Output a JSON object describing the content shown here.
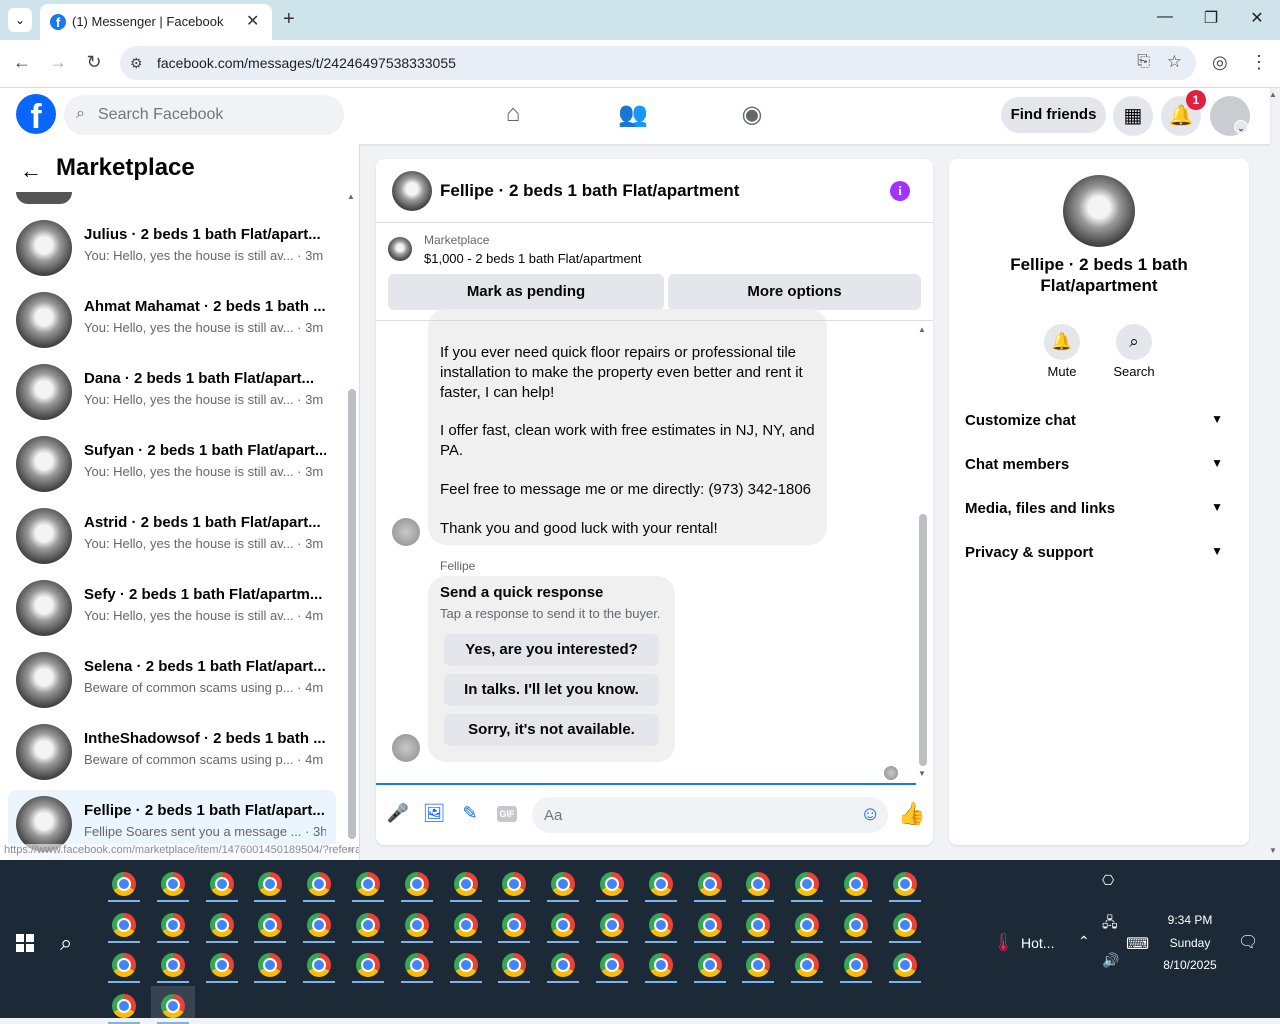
{
  "browser": {
    "tab_title": "(1) Messenger | Facebook",
    "url": "facebook.com/messages/t/24246497538333055",
    "status_url": "https://www.facebook.com/marketplace/item/1476001450189504/?referralS..."
  },
  "fb_header": {
    "search_placeholder": "Search Facebook",
    "find_friends_label": "Find friends",
    "notification_count": "1"
  },
  "left_panel": {
    "title": "Marketplace",
    "conversations": [
      {
        "name": "Julius · 2 beds 1 bath Flat/apart...",
        "preview": "You: Hello, yes the house is still av... · 3m"
      },
      {
        "name": "Ahmat Mahamat · 2 beds 1 bath ...",
        "preview": "You: Hello, yes the house is still av... · 3m"
      },
      {
        "name": "Dana · 2 beds 1 bath Flat/apart...",
        "preview": "You: Hello, yes the house is still av... · 3m"
      },
      {
        "name": "Sufyan · 2 beds 1 bath Flat/apart...",
        "preview": "You: Hello, yes the house is still av... · 3m"
      },
      {
        "name": "Astrid · 2 beds 1 bath Flat/apart...",
        "preview": "You: Hello, yes the house is still av... · 3m"
      },
      {
        "name": "Sefy · 2 beds 1 bath Flat/apartm...",
        "preview": "You: Hello, yes the house is still av... · 4m"
      },
      {
        "name": "Selena · 2 beds 1 bath Flat/apart...",
        "preview": "Beware of common scams using p... · 4m"
      },
      {
        "name": "IntheShadowsof · 2 beds 1 bath ...",
        "preview": "Beware of common scams using p... · 4m"
      },
      {
        "name": "Fellipe · 2 beds 1 bath Flat/apart...",
        "preview": "Fellipe Soares sent you a message ... · 3h"
      }
    ]
  },
  "chat": {
    "title": "Fellipe · 2 beds 1 bath Flat/apartment",
    "item_source": "Marketplace",
    "item_price": "$1,000 - 2 beds 1 bath Flat/apartment",
    "mark_pending_label": "Mark as pending",
    "more_options_label": "More options",
    "message_paragraphs": [
      "If you ever need quick floor repairs or professional tile installation to make the property even better and rent it faster, I can help!",
      "I offer fast, clean work with free estimates in NJ, NY, and PA.",
      "Feel free to message me or me directly: (973) 342-1806",
      "Thank you and good luck with your rental!"
    ],
    "sender_name": "Fellipe",
    "quick_response": {
      "title": "Send a quick response",
      "subtitle": "Tap a response to send it to the buyer.",
      "options": [
        "Yes, are you interested?",
        "In talks. I'll let you know.",
        "Sorry, it's not available."
      ]
    },
    "composer_placeholder": "Aa"
  },
  "right_panel": {
    "title": "Fellipe · 2 beds 1 bath Flat/apartment",
    "actions": [
      {
        "label": "Mute",
        "icon": "bell-icon"
      },
      {
        "label": "Search",
        "icon": "search-icon"
      }
    ],
    "sections": [
      "Customize chat",
      "Chat members",
      "Media, files and links",
      "Privacy & support"
    ]
  },
  "taskbar": {
    "weather": "Hot...",
    "time": "9:34 PM",
    "day": "Sunday",
    "date": "8/10/2025"
  },
  "colors": {
    "fb_blue": "#0866ff",
    "info_purple": "#a033ff",
    "badge_red": "#e41e3f",
    "taskbar": "#1c2a38"
  }
}
